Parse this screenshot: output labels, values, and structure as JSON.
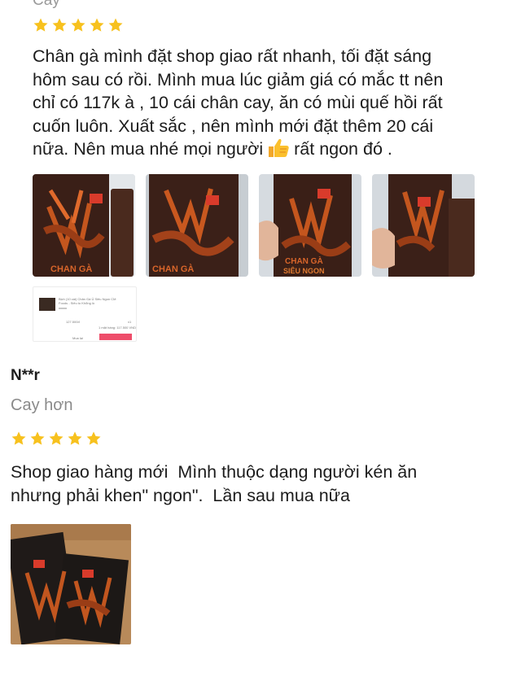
{
  "review1": {
    "variant_partial": "Cay",
    "rating": 5,
    "text_before_emoji": "Chân gà mình đặt shop giao rất nhanh, tối đặt sáng\nhôm sau có rồi. Mình mua lúc giảm giá có mắc tt nên\nchỉ có 117k à , 10 cái chân cay, ăn có mùi quế hồi rất\ncuốn luôn. Xuất sắc , nên mình mới đặt thêm 20 cái\nnữa. Nên mua nhé mọi người",
    "emoji_icon": "thumbs-up-icon",
    "text_after_emoji": "rất ngon đó .",
    "photo_label_1": "CHAN GÀ",
    "photo_label_2": "SIÊU NGON",
    "photo_brand": "CH",
    "screenshot_thumb": {
      "product_line": "Bịch (10 cái) Chân Gà Ủ Siêu Ngon CM",
      "product_line2": "Foods - Siêu to Khổng lồ",
      "price": "127.500đ",
      "qty": "x1",
      "total": "1 mặt hàng: 117.500 VND",
      "left_button": "Mua lại",
      "right_button": "Xem đánh giá"
    }
  },
  "review2": {
    "username": "N**r",
    "variant": "Cay hơn",
    "rating": 5,
    "text": "Shop giao hàng mới  Mình thuộc dạng người kén ăn\nnhưng phải khen\" ngon\".  Lần sau mua nữa"
  },
  "colors": {
    "star": "#f7c11e",
    "text": "#1c1c1c",
    "muted": "#8a8a8a",
    "package_bg": "#3b2219",
    "package_orange": "#c2561f"
  }
}
